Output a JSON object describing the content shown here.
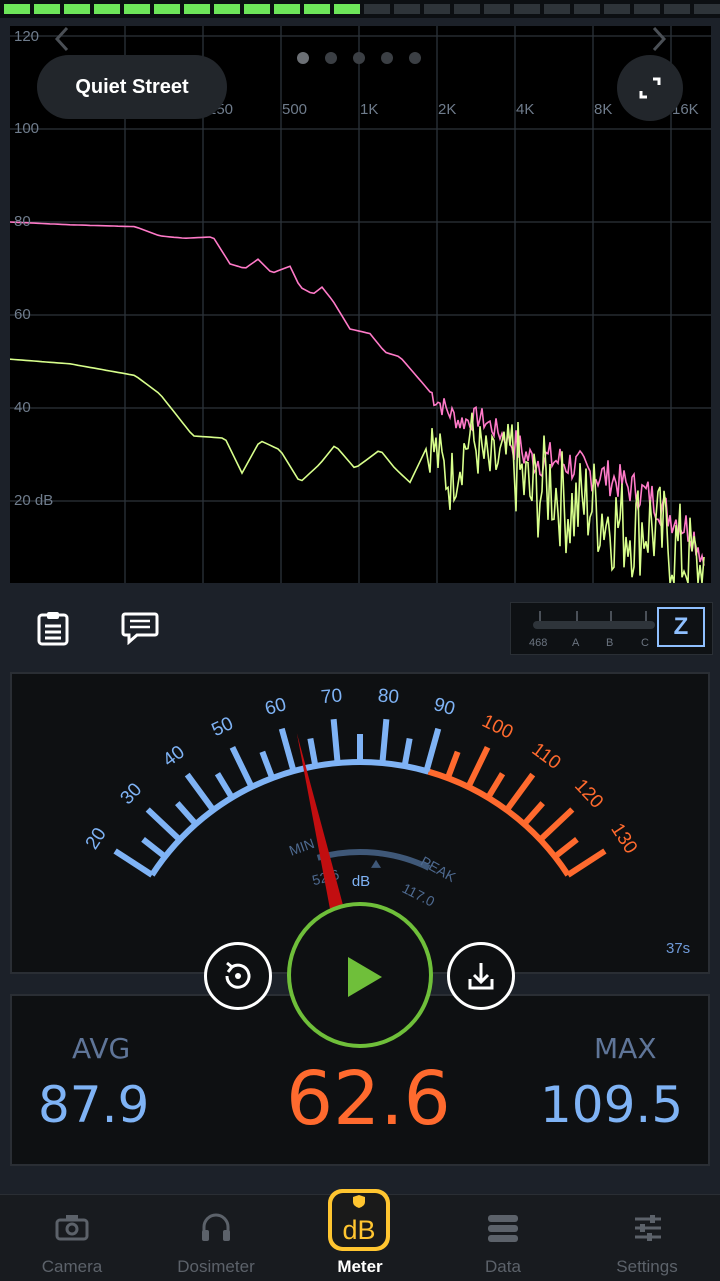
{
  "level_meter": {
    "lit_fraction": 0.5,
    "lit_color": "#6ee65a"
  },
  "spectrum": {
    "preset_label": "Quiet Street",
    "y_ticks": [
      "120",
      "100",
      "80",
      "60",
      "40",
      "20 dB"
    ],
    "x_ticks": [
      "250",
      "500",
      "1K",
      "2K",
      "4K",
      "8K",
      "16K"
    ],
    "page_count": 5,
    "active_page": 0,
    "peak_color": "#ff7ac8",
    "level_color": "#d8ff8c"
  },
  "toolbar": {
    "clipboard_icon": "clipboard-icon",
    "comment_icon": "comment-icon"
  },
  "weighting": {
    "options": [
      "468",
      "A",
      "B",
      "C"
    ],
    "selected": "Z"
  },
  "meter": {
    "scale_labels": [
      "20",
      "30",
      "40",
      "50",
      "60",
      "70",
      "80",
      "90",
      "100",
      "110",
      "120",
      "130"
    ],
    "unit": "dB",
    "min_label": "MIN",
    "min_value": "52.6",
    "peak_label": "PEAK",
    "peak_value": "117.0",
    "needle_value": 62.6,
    "elapsed": "37s",
    "scale_color_normal": "#7fb3f5",
    "scale_color_loud": "#ff6a2e"
  },
  "readings": {
    "avg_label": "AVG",
    "avg_value": "87.9",
    "current_value": "62.6",
    "max_label": "MAX",
    "max_value": "109.5"
  },
  "tabs": [
    {
      "label": "Camera",
      "icon": "camera-icon"
    },
    {
      "label": "Dosimeter",
      "icon": "headphones-icon"
    },
    {
      "label": "Meter",
      "icon": "db-badge-icon",
      "active": true
    },
    {
      "label": "Data",
      "icon": "database-icon"
    },
    {
      "label": "Settings",
      "icon": "sliders-icon"
    }
  ]
}
